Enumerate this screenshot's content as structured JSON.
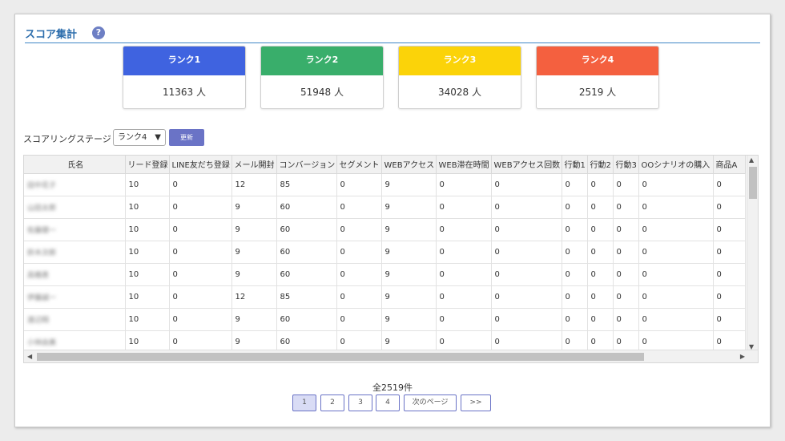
{
  "header": {
    "title": "スコア集計",
    "help_icon": "?"
  },
  "ranks": [
    {
      "label": "ランク1",
      "value": "11363 人",
      "color": "#3f63e0"
    },
    {
      "label": "ランク2",
      "value": "51948 人",
      "color": "#39ae6b"
    },
    {
      "label": "ランク3",
      "value": "34028 人",
      "color": "#fbd309"
    },
    {
      "label": "ランク4",
      "value": "2519 人",
      "color": "#f4603f"
    }
  ],
  "stage": {
    "label": "スコアリングステージ",
    "selected": "ランク4",
    "update_label": "更新"
  },
  "table": {
    "columns": [
      "氏名",
      "リード登録",
      "LINE友だち登録",
      "メール開封",
      "コンバージョン",
      "セグメント",
      "WEBアクセス",
      "WEB滞在時間",
      "WEBアクセス回数",
      "行動1",
      "行動2",
      "行動3",
      "OOシナリオの購入",
      "商品A"
    ],
    "rows": [
      [
        "田中花子",
        "10",
        "0",
        "12",
        "85",
        "0",
        "9",
        "0",
        "0",
        "0",
        "0",
        "0",
        "0",
        "0"
      ],
      [
        "山田太郎",
        "10",
        "0",
        "9",
        "60",
        "0",
        "9",
        "0",
        "0",
        "0",
        "0",
        "0",
        "0",
        "0"
      ],
      [
        "佐藤健一",
        "10",
        "0",
        "9",
        "60",
        "0",
        "9",
        "0",
        "0",
        "0",
        "0",
        "0",
        "0",
        "0"
      ],
      [
        "鈴木次郎",
        "10",
        "0",
        "9",
        "60",
        "0",
        "9",
        "0",
        "0",
        "0",
        "0",
        "0",
        "0",
        "0"
      ],
      [
        "高橋恵",
        "10",
        "0",
        "9",
        "60",
        "0",
        "9",
        "0",
        "0",
        "0",
        "0",
        "0",
        "0",
        "0"
      ],
      [
        "伊藤誠一",
        "10",
        "0",
        "12",
        "85",
        "0",
        "9",
        "0",
        "0",
        "0",
        "0",
        "0",
        "0",
        "0"
      ],
      [
        "渡辺翔",
        "10",
        "0",
        "9",
        "60",
        "0",
        "9",
        "0",
        "0",
        "0",
        "0",
        "0",
        "0",
        "0"
      ],
      [
        "小林由美",
        "10",
        "0",
        "9",
        "60",
        "0",
        "9",
        "0",
        "0",
        "0",
        "0",
        "0",
        "0",
        "0"
      ]
    ]
  },
  "pagination": {
    "total": "全2519件",
    "pages": [
      "1",
      "2",
      "3",
      "4"
    ],
    "next_label": "次のページ",
    "last_label": ">>"
  }
}
